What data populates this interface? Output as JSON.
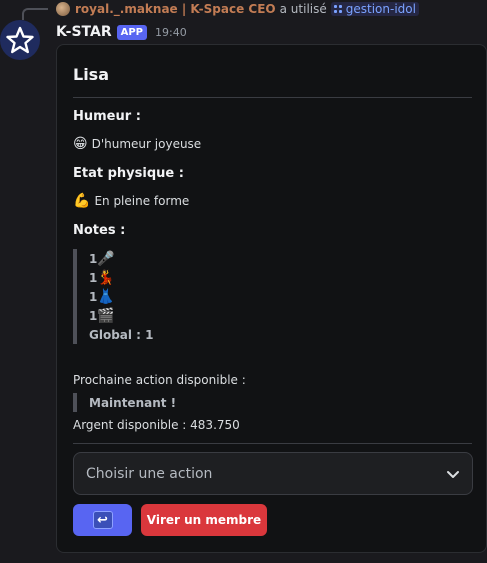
{
  "reply": {
    "user": "royal._.maknae | K-Space CEO",
    "action": "a utilisé",
    "command": "gestion-idol"
  },
  "message": {
    "bot_name": "K-STAR",
    "app_tag": "APP",
    "time": "19:40"
  },
  "embed": {
    "title": "Lisa",
    "mood_label": "Humeur :",
    "mood_emoji": "😁",
    "mood_value": "D'humeur joyeuse",
    "physical_label": "Etat physique :",
    "physical_emoji": "💪",
    "physical_value": "En pleine forme",
    "notes_label": "Notes :",
    "notes": [
      {
        "value": "1",
        "emoji": "🎤"
      },
      {
        "value": "1",
        "emoji": "💃"
      },
      {
        "value": "1",
        "emoji": "👗"
      },
      {
        "value": "1",
        "emoji": "🎬"
      }
    ],
    "notes_global": "Global : 1",
    "next_action_label": "Prochaine action disponible :",
    "next_action_value": "Maintenant !",
    "money_label": "Argent disponible : 483.750"
  },
  "controls": {
    "select_placeholder": "Choisir une action",
    "refresh_icon": "↩",
    "kick_label": "Virer un membre"
  },
  "colors": {
    "blurple": "#5865f2",
    "danger": "#da373c",
    "reply_user": "#c27c54"
  }
}
